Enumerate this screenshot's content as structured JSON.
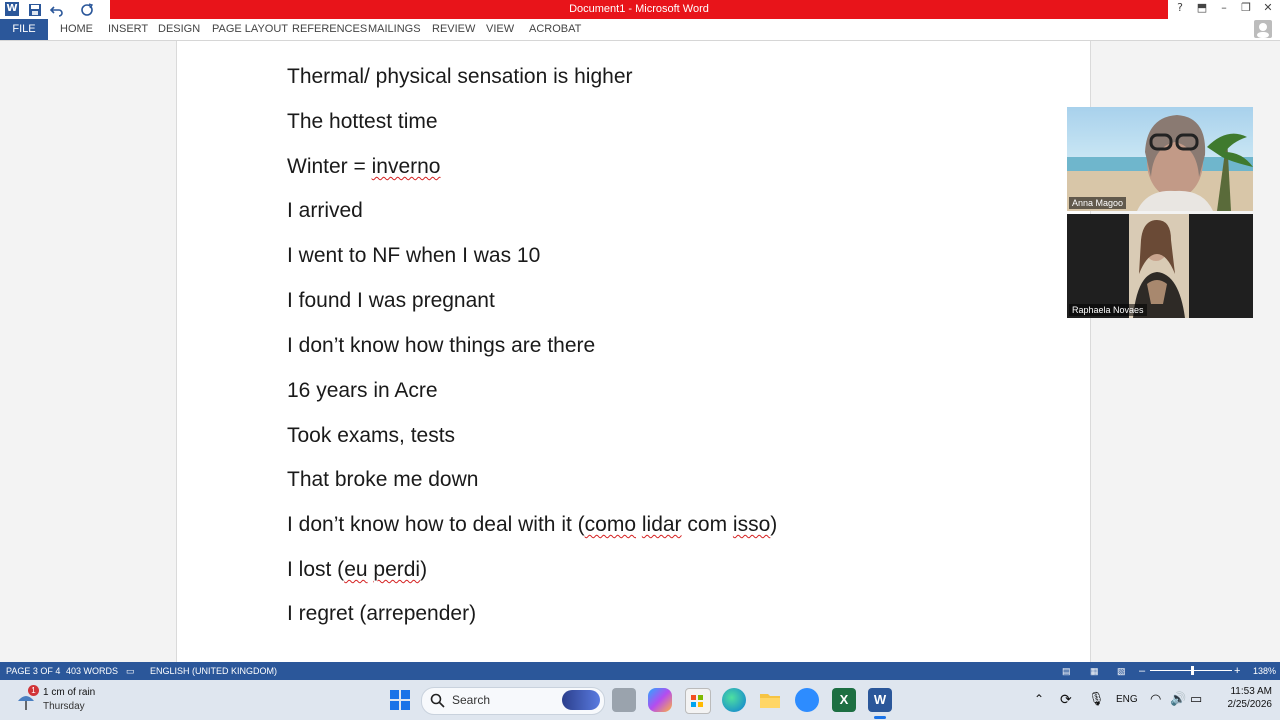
{
  "window": {
    "title": "Document1 - Microsoft Word",
    "help": "?",
    "minimize": "–",
    "restore": "❐",
    "close": "✕"
  },
  "ribbon": {
    "file": "FILE",
    "tabs": [
      "HOME",
      "INSERT",
      "DESIGN",
      "PAGE LAYOUT",
      "REFERENCES",
      "MAILINGS",
      "REVIEW",
      "VIEW",
      "ACROBAT"
    ]
  },
  "document": {
    "lines": [
      "Thermal/ physical sensation is higher",
      "The hottest time",
      "Winter = ",
      "I arrived",
      "I went to NF when I was 10",
      "I found I was pregnant",
      "I don’t know how things are there",
      "16 years in Acre",
      "Took exams, tests",
      "That broke me down",
      "I don’t know how to deal with it (",
      "I lost (",
      "I regret (arrepender)"
    ],
    "winter_word": "inverno",
    "deal_pt1": "como",
    "deal_pt2": "lidar",
    "deal_pt3": "com",
    "deal_pt4": "isso",
    "deal_close": ")",
    "lost_pt1": "eu",
    "lost_pt2": "perdi",
    "lost_close": ")"
  },
  "video": {
    "participant1": "Anna Magoo",
    "participant2": "Raphaela Novaes"
  },
  "status": {
    "page": "PAGE 3 OF 4",
    "words": "403 WORDS",
    "language": "ENGLISH (UNITED KINGDOM)",
    "zoom": "138%"
  },
  "taskbar": {
    "weather_badge": "1",
    "weather_text": "1 cm of rain",
    "weather_day": "Thursday",
    "search_placeholder": "Search",
    "lang": "ENG",
    "time": "11:53 AM",
    "date": "2/25/2026"
  },
  "colors": {
    "title_red": "#e8141a",
    "word_blue": "#2b579a",
    "spell_red": "#d42020"
  }
}
